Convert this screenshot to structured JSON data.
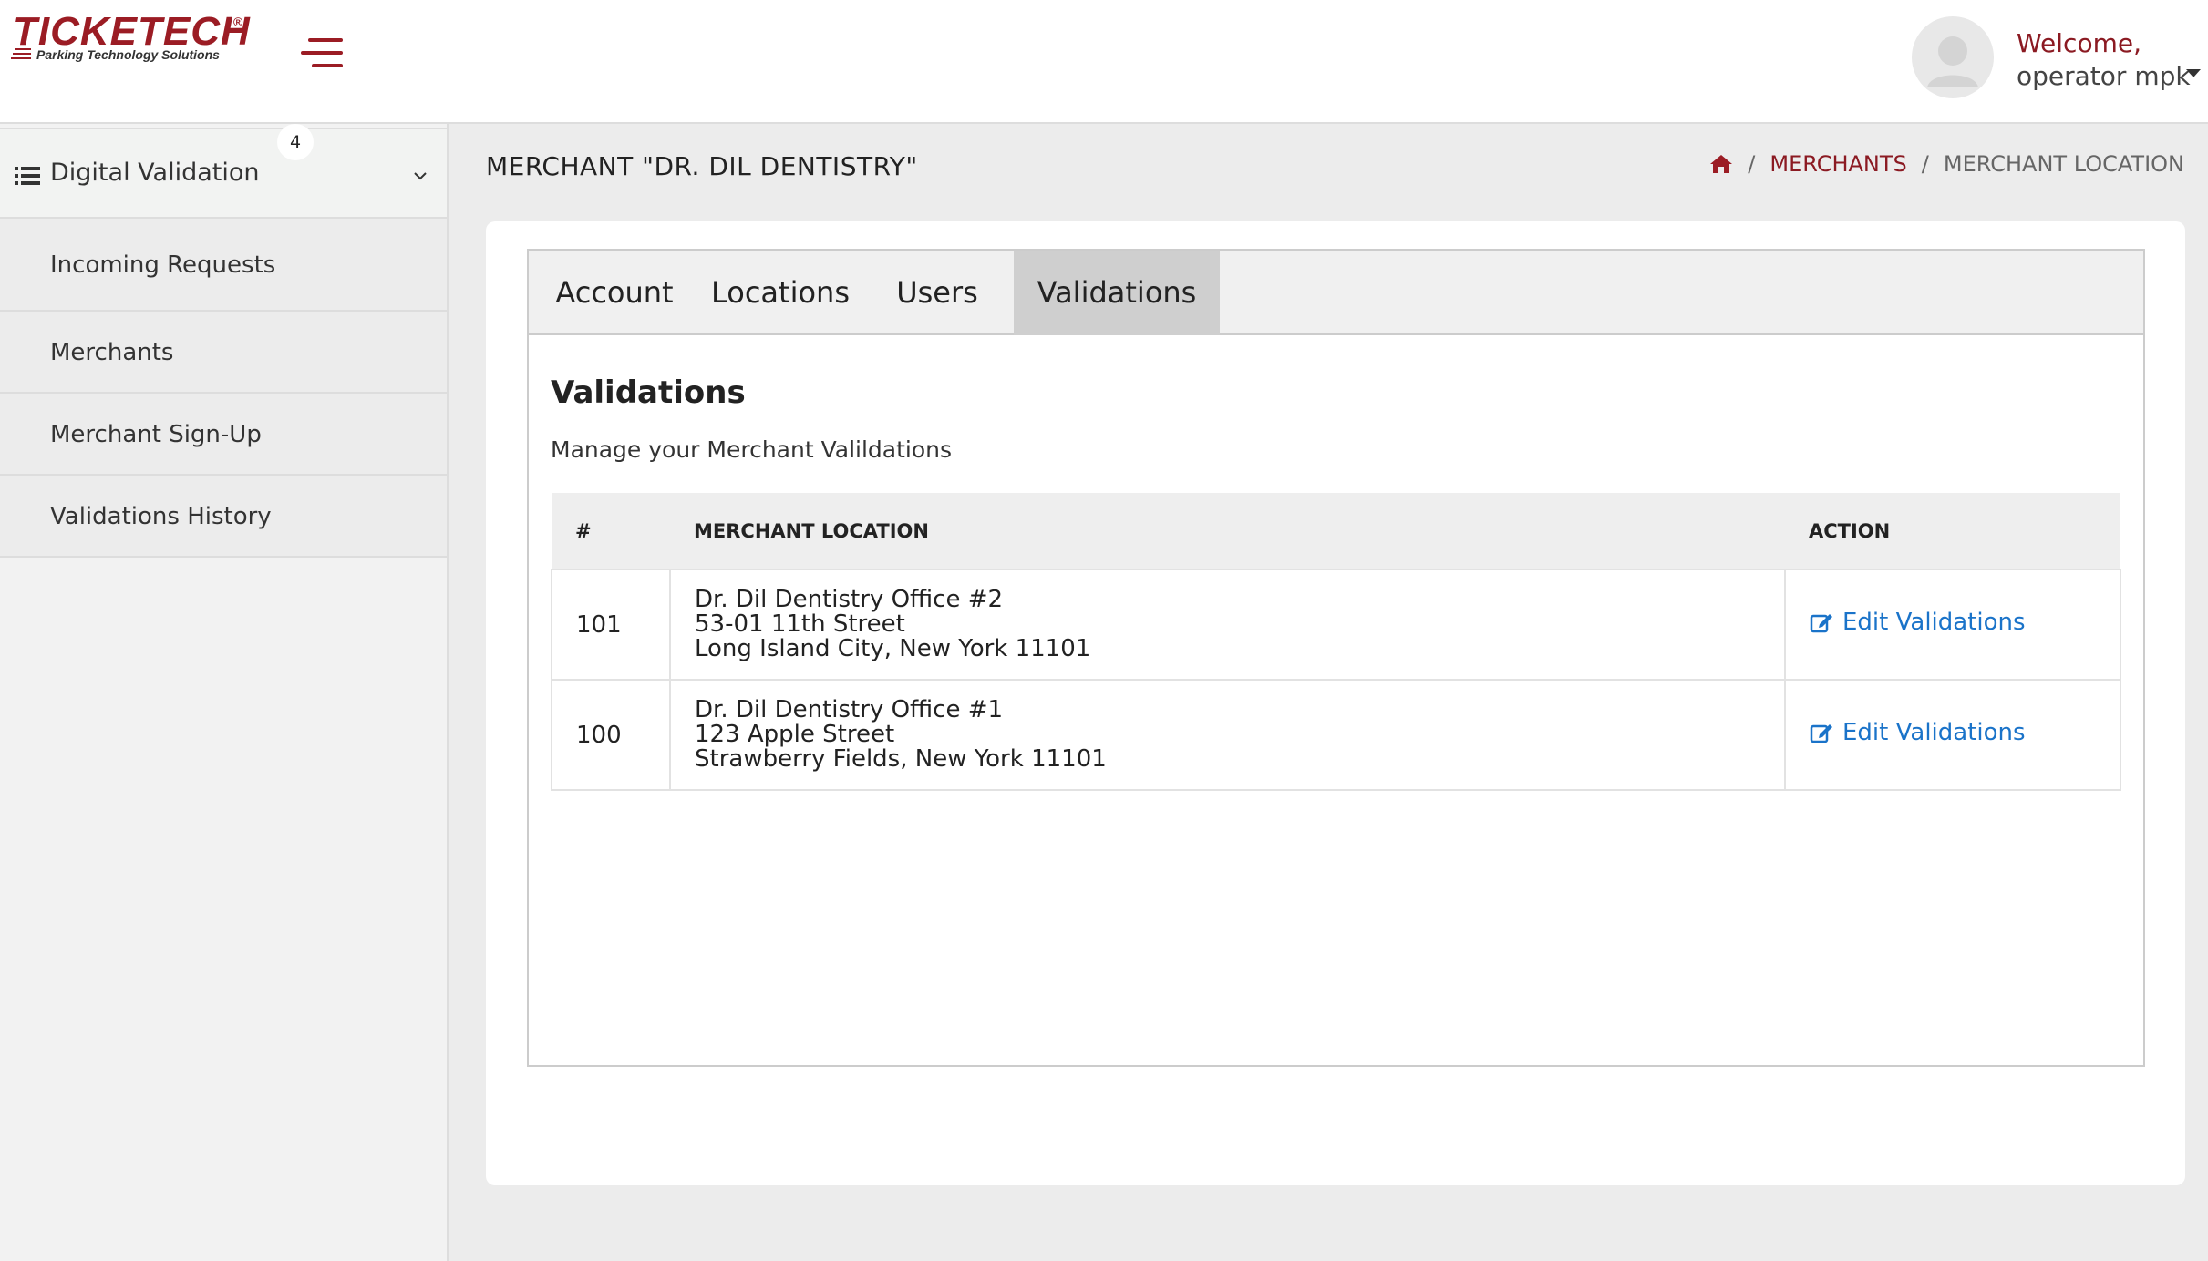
{
  "header": {
    "logo_text": "TICKETECH",
    "logo_reg": "®",
    "logo_tagline": "Parking Technology Solutions",
    "welcome_line1": "Welcome,",
    "welcome_line2": "operator mpk"
  },
  "sidebar": {
    "section_title": "Digital Validation",
    "items": [
      {
        "label": "Incoming Requests",
        "badge": "4"
      },
      {
        "label": "Merchants"
      },
      {
        "label": "Merchant Sign-Up"
      },
      {
        "label": "Validations History"
      }
    ]
  },
  "page": {
    "title": "MERCHANT \"DR. DIL DENTISTRY\"",
    "breadcrumb": {
      "sep": "/",
      "link": "MERCHANTS",
      "current": "MERCHANT LOCATION"
    }
  },
  "tabs": [
    {
      "label": "Account"
    },
    {
      "label": "Locations"
    },
    {
      "label": "Users"
    },
    {
      "label": "Validations",
      "active": true
    }
  ],
  "validations": {
    "heading": "Validations",
    "subtitle": "Manage your Merchant Valildations",
    "columns": [
      "#",
      "MERCHANT LOCATION",
      "ACTION"
    ],
    "rows": [
      {
        "id": "101",
        "line1": "Dr. Dil Dentistry Office #2",
        "line2": "53-01 11th Street",
        "line3": "Long Island City, New York 11101",
        "action": "Edit Validations"
      },
      {
        "id": "100",
        "line1": "Dr. Dil Dentistry Office #1",
        "line2": "123 Apple Street",
        "line3": "Strawberry Fields, New York 11101",
        "action": "Edit Validations"
      }
    ]
  },
  "colors": {
    "brand": "#9b1c24",
    "link": "#1a73c9",
    "active_tab": "#cfcfcf"
  },
  "icons": {
    "hamburger": "hamburger-menu-icon",
    "home": "home-icon",
    "list": "list-icon",
    "chevron": "chevron-down-icon",
    "edit": "edit-icon",
    "avatar": "user-avatar-icon"
  }
}
